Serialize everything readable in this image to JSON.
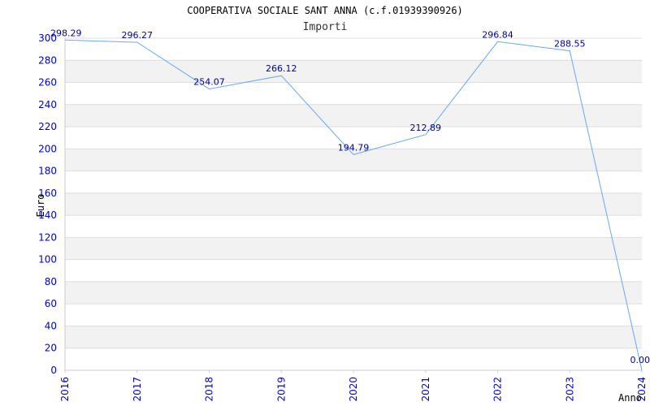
{
  "chart_data": {
    "type": "line",
    "title": "COOPERATIVA SOCIALE SANT ANNA (c.f.01939390926)",
    "subtitle": "Importi",
    "xlabel": "Anno",
    "ylabel": "Euro",
    "categories": [
      "2016",
      "2017",
      "2018",
      "2019",
      "2020",
      "2021",
      "2022",
      "2023",
      "2024"
    ],
    "series": [
      {
        "values": [
          298.29,
          296.27,
          254.07,
          266.12,
          194.79,
          212.89,
          296.84,
          288.55,
          0.0
        ],
        "labels": [
          "298.29",
          "296.27",
          "254.07",
          "266.12",
          "194.79",
          "212.89",
          "296.84",
          "288.55",
          "0.00"
        ]
      }
    ],
    "ylim": [
      0,
      300
    ],
    "yticks": [
      0,
      20,
      40,
      60,
      80,
      100,
      120,
      140,
      160,
      180,
      200,
      220,
      240,
      260,
      280,
      300
    ],
    "grid": true,
    "colors": {
      "line": "#66aaee",
      "band": "#f2f2f2",
      "grid": "#dddddd",
      "tick": "#0000cc",
      "data_label": "#000099"
    }
  }
}
